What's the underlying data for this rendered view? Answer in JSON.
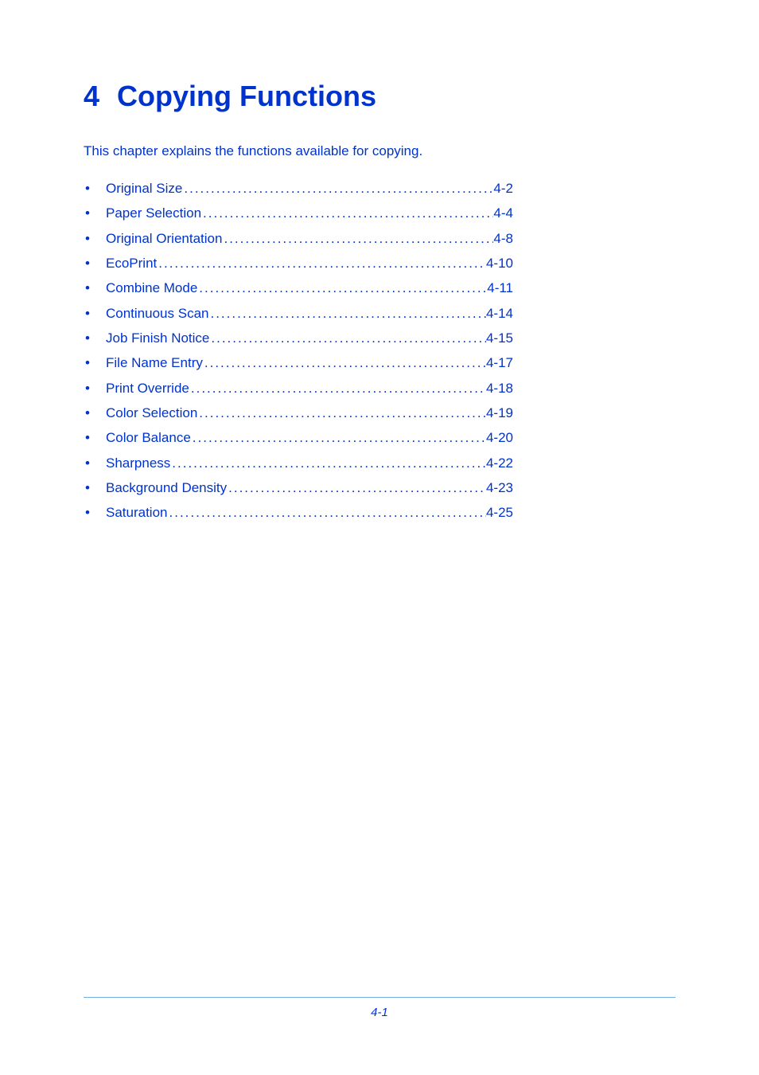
{
  "chapter": {
    "number": "4",
    "title": "Copying Functions"
  },
  "intro": "This chapter explains the functions available for copying.",
  "toc": [
    {
      "label": "Original Size",
      "page": "4-2"
    },
    {
      "label": "Paper Selection",
      "page": "4-4"
    },
    {
      "label": "Original Orientation",
      "page": "4-8"
    },
    {
      "label": "EcoPrint",
      "page": "4-10"
    },
    {
      "label": "Combine Mode",
      "page": " 4-11"
    },
    {
      "label": "Continuous Scan",
      "page": "4-14"
    },
    {
      "label": "Job Finish Notice",
      "page": "4-15"
    },
    {
      "label": "File Name Entry",
      "page": "4-17"
    },
    {
      "label": "Print Override",
      "page": "4-18"
    },
    {
      "label": "Color Selection",
      "page": "4-19"
    },
    {
      "label": "Color Balance",
      "page": "4-20"
    },
    {
      "label": "Sharpness",
      "page": "4-22"
    },
    {
      "label": "Background Density",
      "page": "4-23"
    },
    {
      "label": "Saturation",
      "page": "4-25"
    }
  ],
  "footer": {
    "page_number": "4-1"
  }
}
